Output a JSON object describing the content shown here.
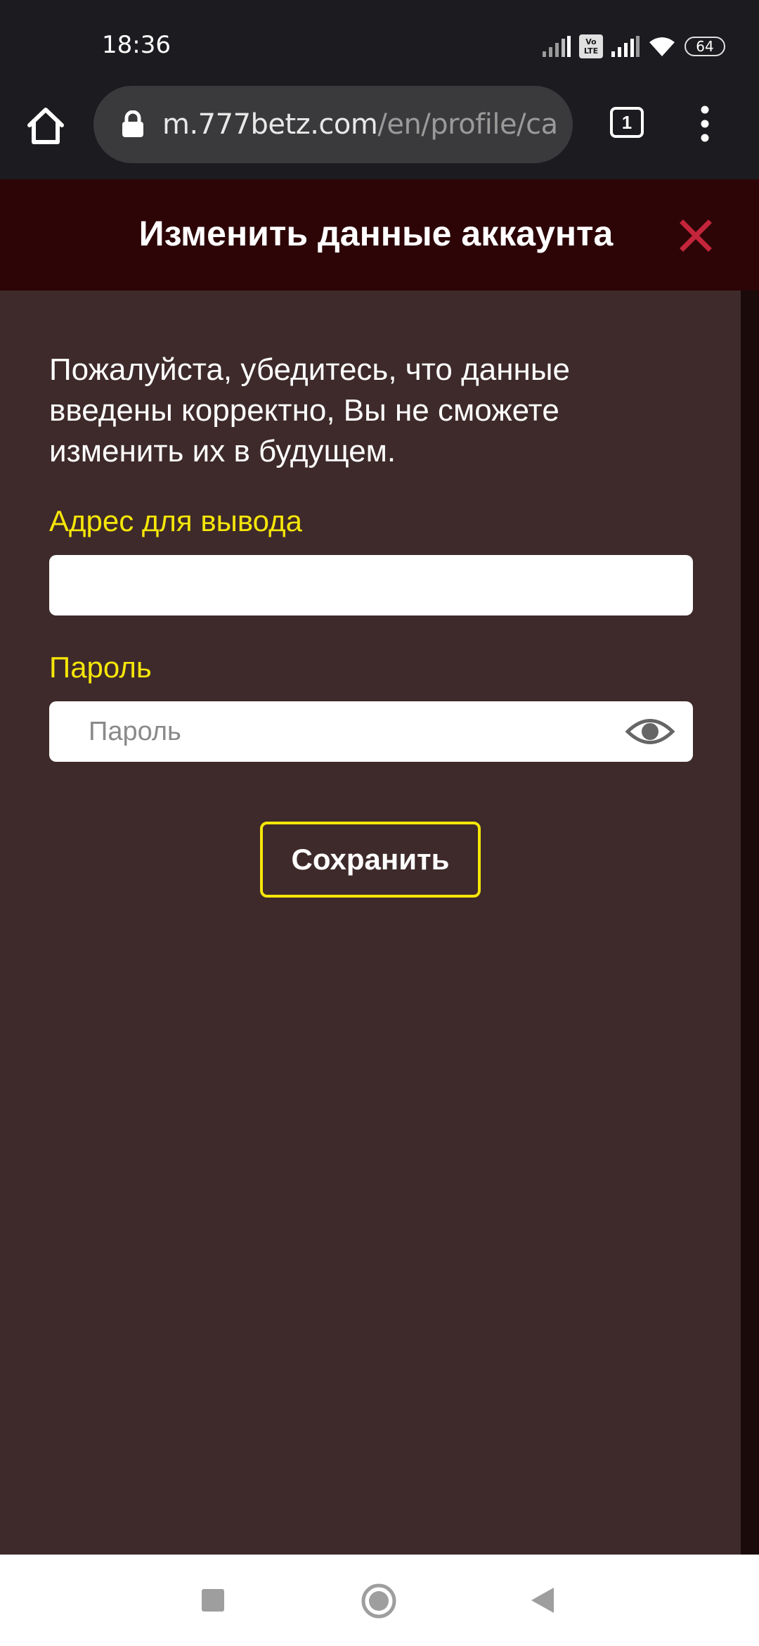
{
  "status_bar": {
    "time": "18:36",
    "volte_label": "Vo LTE",
    "battery_level": "64"
  },
  "browser": {
    "url_host": "m.777betz.com",
    "url_path": "/en/profile/ca",
    "tab_count": "1"
  },
  "modal": {
    "title": "Изменить данные аккаунта",
    "notice": "Пожалуйста, убедитесь, что данные введены корректно, Вы не сможете изменить их в будущем.",
    "address_label": "Адрес для вывода",
    "address_value": "",
    "password_label": "Пароль",
    "password_placeholder": "Пароль",
    "save_label": "Сохранить"
  },
  "colors": {
    "accent_yellow": "#f5e60a",
    "close_red": "#c4253b",
    "header_bg": "#2d0507",
    "body_bg": "#3e2a2a"
  },
  "icons": {
    "home": "home-icon",
    "lock": "lock-icon",
    "menu": "more-vert-icon",
    "close": "close-icon",
    "eye": "eye-icon",
    "nav_recent": "square-icon",
    "nav_home": "circle-icon",
    "nav_back": "triangle-back-icon"
  }
}
